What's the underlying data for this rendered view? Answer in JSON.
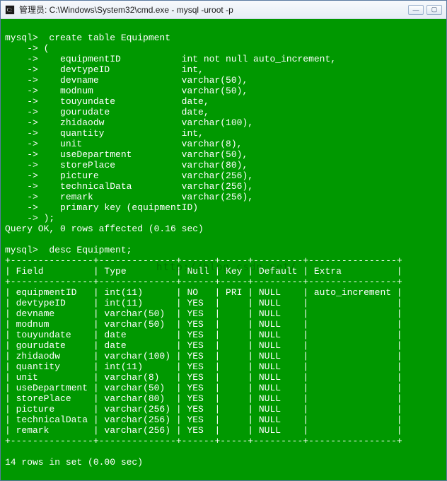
{
  "window": {
    "title": "管理员: C:\\Windows\\System32\\cmd.exe - mysql  -uroot -p",
    "icon_name": "cmd-icon",
    "buttons": {
      "min": "—",
      "max": "▢",
      "close": ""
    }
  },
  "watermark": "http://blog.csdn.net/",
  "create_block": {
    "prompt": "mysql>",
    "stmt": "create table Equipment",
    "open": "(",
    "cols": [
      {
        "name": "equipmentID",
        "def": "int not null auto_increment,"
      },
      {
        "name": "devtypeID",
        "def": "int,"
      },
      {
        "name": "devname",
        "def": "varchar(50),"
      },
      {
        "name": "modnum",
        "def": "varchar(50),"
      },
      {
        "name": "touyundate",
        "def": "date,"
      },
      {
        "name": "gourudate",
        "def": "date,"
      },
      {
        "name": "zhidaodw",
        "def": "varchar(100),"
      },
      {
        "name": "quantity",
        "def": "int,"
      },
      {
        "name": "unit",
        "def": "varchar(8),"
      },
      {
        "name": "useDepartment",
        "def": "varchar(50),"
      },
      {
        "name": "storePlace",
        "def": "varchar(80),"
      },
      {
        "name": "picture",
        "def": "varchar(256),"
      },
      {
        "name": "technicalData",
        "def": "varchar(256),"
      },
      {
        "name": "remark",
        "def": "varchar(256),"
      }
    ],
    "pk": "primary key (equipmentID)",
    "close": ");",
    "result": "Query OK, 0 rows affected (0.16 sec)"
  },
  "desc_block": {
    "prompt": "mysql>",
    "stmt": "desc Equipment;",
    "headers": {
      "field": "Field",
      "type": "Type",
      "null": "Null",
      "key": "Key",
      "default": "Default",
      "extra": "Extra"
    },
    "rows": [
      {
        "field": "equipmentID",
        "type": "int(11)",
        "null": "NO",
        "key": "PRI",
        "default": "NULL",
        "extra": "auto_increment"
      },
      {
        "field": "devtypeID",
        "type": "int(11)",
        "null": "YES",
        "key": "",
        "default": "NULL",
        "extra": ""
      },
      {
        "field": "devname",
        "type": "varchar(50)",
        "null": "YES",
        "key": "",
        "default": "NULL",
        "extra": ""
      },
      {
        "field": "modnum",
        "type": "varchar(50)",
        "null": "YES",
        "key": "",
        "default": "NULL",
        "extra": ""
      },
      {
        "field": "touyundate",
        "type": "date",
        "null": "YES",
        "key": "",
        "default": "NULL",
        "extra": ""
      },
      {
        "field": "gourudate",
        "type": "date",
        "null": "YES",
        "key": "",
        "default": "NULL",
        "extra": ""
      },
      {
        "field": "zhidaodw",
        "type": "varchar(100)",
        "null": "YES",
        "key": "",
        "default": "NULL",
        "extra": ""
      },
      {
        "field": "quantity",
        "type": "int(11)",
        "null": "YES",
        "key": "",
        "default": "NULL",
        "extra": ""
      },
      {
        "field": "unit",
        "type": "varchar(8)",
        "null": "YES",
        "key": "",
        "default": "NULL",
        "extra": ""
      },
      {
        "field": "useDepartment",
        "type": "varchar(50)",
        "null": "YES",
        "key": "",
        "default": "NULL",
        "extra": ""
      },
      {
        "field": "storePlace",
        "type": "varchar(80)",
        "null": "YES",
        "key": "",
        "default": "NULL",
        "extra": ""
      },
      {
        "field": "picture",
        "type": "varchar(256)",
        "null": "YES",
        "key": "",
        "default": "NULL",
        "extra": ""
      },
      {
        "field": "technicalData",
        "type": "varchar(256)",
        "null": "YES",
        "key": "",
        "default": "NULL",
        "extra": ""
      },
      {
        "field": "remark",
        "type": "varchar(256)",
        "null": "YES",
        "key": "",
        "default": "NULL",
        "extra": ""
      }
    ],
    "footer": "14 rows in set (0.00 sec)"
  },
  "chart_data": {
    "type": "table",
    "title": "desc Equipment;",
    "columns": [
      "Field",
      "Type",
      "Null",
      "Key",
      "Default",
      "Extra"
    ],
    "rows": [
      [
        "equipmentID",
        "int(11)",
        "NO",
        "PRI",
        "NULL",
        "auto_increment"
      ],
      [
        "devtypeID",
        "int(11)",
        "YES",
        "",
        "NULL",
        ""
      ],
      [
        "devname",
        "varchar(50)",
        "YES",
        "",
        "NULL",
        ""
      ],
      [
        "modnum",
        "varchar(50)",
        "YES",
        "",
        "NULL",
        ""
      ],
      [
        "touyundate",
        "date",
        "YES",
        "",
        "NULL",
        ""
      ],
      [
        "gourudate",
        "date",
        "YES",
        "",
        "NULL",
        ""
      ],
      [
        "zhidaodw",
        "varchar(100)",
        "YES",
        "",
        "NULL",
        ""
      ],
      [
        "quantity",
        "int(11)",
        "YES",
        "",
        "NULL",
        ""
      ],
      [
        "unit",
        "varchar(8)",
        "YES",
        "",
        "NULL",
        ""
      ],
      [
        "useDepartment",
        "varchar(50)",
        "YES",
        "",
        "NULL",
        ""
      ],
      [
        "storePlace",
        "varchar(80)",
        "YES",
        "",
        "NULL",
        ""
      ],
      [
        "picture",
        "varchar(256)",
        "YES",
        "",
        "NULL",
        ""
      ],
      [
        "technicalData",
        "varchar(256)",
        "YES",
        "",
        "NULL",
        ""
      ],
      [
        "remark",
        "varchar(256)",
        "YES",
        "",
        "NULL",
        ""
      ]
    ]
  }
}
